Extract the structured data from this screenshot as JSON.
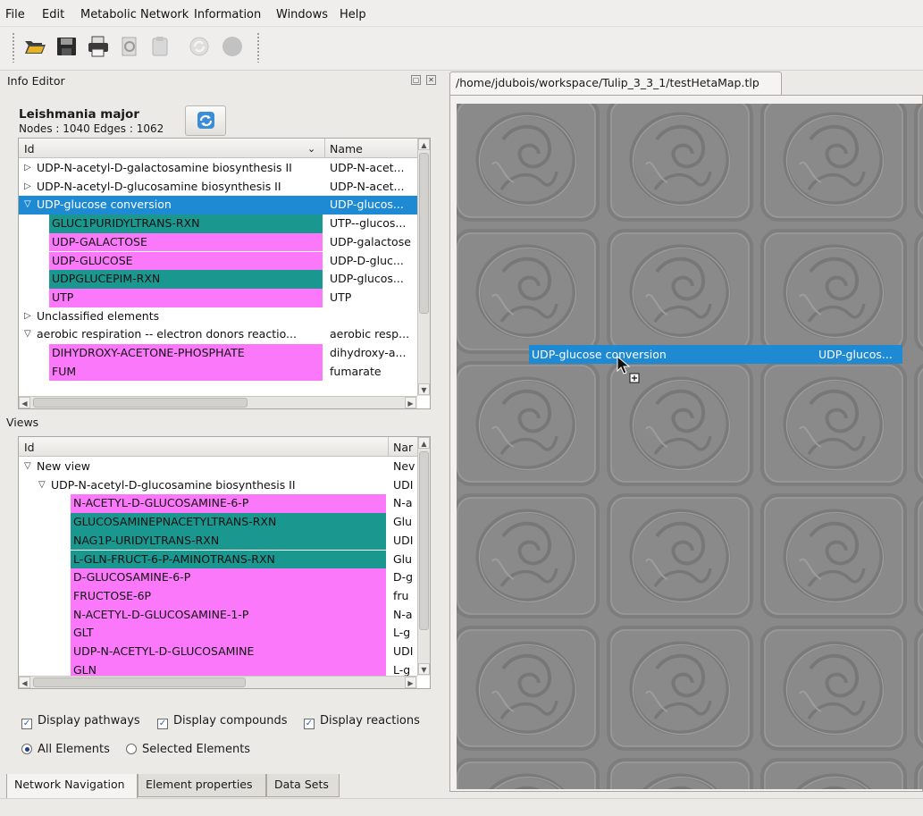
{
  "menu": {
    "file": "File",
    "edit": "Edit",
    "metabolic": "Metabolic Network",
    "information": "Information",
    "windows": "Windows",
    "help": "Help"
  },
  "dock": {
    "title": "Info Editor"
  },
  "graph": {
    "name": "Leishmania major",
    "stats": "Nodes : 1040 Edges : 1062"
  },
  "info_tree": {
    "col_id": "Id",
    "col_name": "Name",
    "rows": [
      {
        "indent": 0,
        "exp": "right",
        "id": "UDP-N-acetyl-D-galactosamine biosynthesis II",
        "name": "UDP-N-acet...",
        "color": "none"
      },
      {
        "indent": 0,
        "exp": "right",
        "id": "UDP-N-acetyl-D-glucosamine biosynthesis II",
        "name": "UDP-N-acet...",
        "color": "none"
      },
      {
        "indent": 0,
        "exp": "down",
        "id": "UDP-glucose conversion",
        "name": "UDP-glucos...",
        "color": "selected"
      },
      {
        "indent": 1,
        "exp": "",
        "id": "GLUC1PURIDYLTRANS-RXN",
        "name": "UTP--glucos...",
        "color": "teal"
      },
      {
        "indent": 1,
        "exp": "",
        "id": "UDP-GALACTOSE",
        "name": "UDP-galactose",
        "color": "magenta"
      },
      {
        "indent": 1,
        "exp": "",
        "id": "UDP-GLUCOSE",
        "name": "UDP-D-gluc...",
        "color": "magenta"
      },
      {
        "indent": 1,
        "exp": "",
        "id": "UDPGLUCEPIM-RXN",
        "name": "UDP-glucos...",
        "color": "teal"
      },
      {
        "indent": 1,
        "exp": "",
        "id": "UTP",
        "name": "UTP",
        "color": "magenta"
      },
      {
        "indent": 0,
        "exp": "right",
        "id": "Unclassified elements",
        "name": "",
        "color": "none"
      },
      {
        "indent": 0,
        "exp": "down",
        "id": "aerobic respiration -- electron donors reactio...",
        "name": "aerobic resp...",
        "color": "none"
      },
      {
        "indent": 1,
        "exp": "",
        "id": "DIHYDROXY-ACETONE-PHOSPHATE",
        "name": "dihydroxy-a...",
        "color": "magenta"
      },
      {
        "indent": 1,
        "exp": "",
        "id": "FUM",
        "name": "fumarate",
        "color": "magenta"
      }
    ]
  },
  "views": {
    "label": "Views",
    "col_id": "Id",
    "col_name": "Nar",
    "rows": [
      {
        "indent": 0,
        "exp": "down",
        "id": "New view",
        "name": "Nev",
        "color": "none"
      },
      {
        "indent": 1,
        "exp": "down",
        "id": "UDP-N-acetyl-D-glucosamine biosynthesis II",
        "name": "UDI",
        "color": "none"
      },
      {
        "indent": 2,
        "exp": "",
        "id": "N-ACETYL-D-GLUCOSAMINE-6-P",
        "name": "N-a",
        "color": "magenta"
      },
      {
        "indent": 2,
        "exp": "",
        "id": "GLUCOSAMINEPNACETYLTRANS-RXN",
        "name": "Glu",
        "color": "teal"
      },
      {
        "indent": 2,
        "exp": "",
        "id": "NAG1P-URIDYLTRANS-RXN",
        "name": "UDI",
        "color": "teal"
      },
      {
        "indent": 2,
        "exp": "",
        "id": "L-GLN-FRUCT-6-P-AMINOTRANS-RXN",
        "name": "Glu",
        "color": "teal"
      },
      {
        "indent": 2,
        "exp": "",
        "id": "D-GLUCOSAMINE-6-P",
        "name": "D-g",
        "color": "magenta"
      },
      {
        "indent": 2,
        "exp": "",
        "id": "FRUCTOSE-6P",
        "name": "fru",
        "color": "magenta"
      },
      {
        "indent": 2,
        "exp": "",
        "id": "N-ACETYL-D-GLUCOSAMINE-1-P",
        "name": "N-a",
        "color": "magenta"
      },
      {
        "indent": 2,
        "exp": "",
        "id": "GLT",
        "name": "L-g",
        "color": "magenta"
      },
      {
        "indent": 2,
        "exp": "",
        "id": "UDP-N-ACETYL-D-GLUCOSAMINE",
        "name": "UDI",
        "color": "magenta"
      },
      {
        "indent": 2,
        "exp": "",
        "id": "GLN",
        "name": "L-g",
        "color": "magenta"
      }
    ]
  },
  "options": {
    "display_pathways": "Display pathways",
    "display_compounds": "Display compounds",
    "display_reactions": "Display reactions",
    "all_elements": "All Elements",
    "selected_elements": "Selected Elements"
  },
  "bottom_tabs": [
    "Network Navigation",
    "Element properties",
    "Data Sets"
  ],
  "document": {
    "tab": "/home/jdubois/workspace/Tulip_3_3_1/testHetaMap.tlp",
    "drag_id": "UDP-glucose conversion",
    "drag_name": "UDP-glucos..."
  },
  "colors": {
    "magenta": "#fa78f9",
    "teal": "#1a9890",
    "selected": "#1f8ad4",
    "canvas": "#8a8a8a"
  }
}
